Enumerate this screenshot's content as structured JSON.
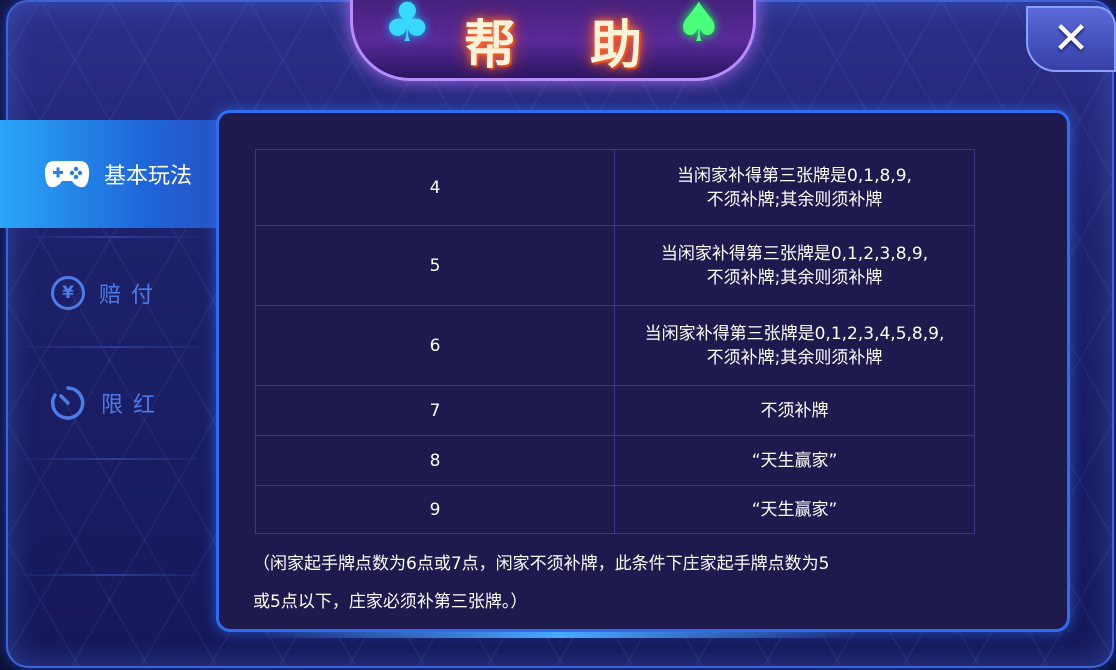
{
  "title": "帮 助",
  "close_glyph": "✕",
  "sidebar": {
    "items": [
      {
        "label": "基本玩法",
        "icon": "gamepad-icon",
        "active": true
      },
      {
        "label": "赔付",
        "icon": "yen-check-icon",
        "icon_glyph": "¥",
        "active": false
      },
      {
        "label": "限红",
        "icon": "timer-icon",
        "active": false
      }
    ]
  },
  "table": {
    "rows": [
      {
        "value": "4",
        "rule_1": "当闲家补得第三张牌是0,1,8,9,",
        "rule_2": "不须补牌;其余则须补牌"
      },
      {
        "value": "5",
        "rule_1": "当闲家补得第三张牌是0,1,2,3,8,9,",
        "rule_2": "不须补牌;其余则须补牌"
      },
      {
        "value": "6",
        "rule_1": "当闲家补得第三张牌是0,1,2,3,4,5,8,9,",
        "rule_2": "不须补牌;其余则须补牌"
      },
      {
        "value": "7",
        "rule_1": "不须补牌",
        "rule_2": ""
      },
      {
        "value": "8",
        "rule_1": "“天生赢家”",
        "rule_2": ""
      },
      {
        "value": "9",
        "rule_1": "“天生赢家”",
        "rule_2": ""
      }
    ]
  },
  "note": {
    "line_1": "（闲家起手牌点数为6点或7点，闲家不须补牌，此条件下庄家起手牌点数为5",
    "line_2": "或5点以下，庄家必须补第三张牌。）"
  },
  "colors": {
    "accent": "#2f6cf0",
    "active_tab": "#2ba6f8",
    "inactive_tab_text": "#4d7ce8",
    "panel_bg": "#1e1a4e"
  }
}
